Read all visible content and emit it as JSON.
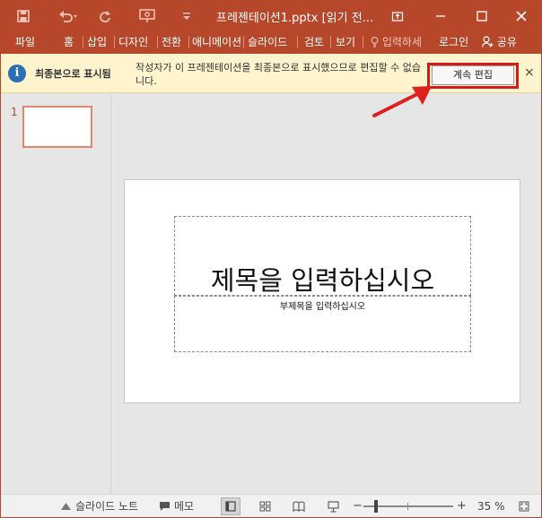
{
  "titlebar": {
    "title": "프레젠테이션1.pptx [읽기 전...",
    "qat_icons": [
      "save-icon",
      "undo-icon",
      "redo-icon",
      "presentation-icon",
      "customize-icon"
    ],
    "controls": [
      "restore-icon",
      "minimize-icon",
      "maximize-icon",
      "close-icon"
    ]
  },
  "ribbon": {
    "tabs": [
      "파일",
      "홈",
      "삽입",
      "디자인",
      "전환",
      "애니메이션",
      "슬라이드",
      "검토",
      "보기"
    ],
    "tell_me": "입력하세",
    "sign_in": "로그인",
    "share": "공유"
  },
  "message_bar": {
    "title": "최종본으로 표시됨",
    "text": "작성자가 이 프레젠테이션을 최종본으로 표시했으므로 편집할 수 없습니다.",
    "edit_button": "계속 편집",
    "close": "×"
  },
  "thumbnails": [
    {
      "number": "1"
    }
  ],
  "slide": {
    "title_placeholder": "제목을 입력하십시오",
    "subtitle_placeholder": "부제목을 입력하십시오"
  },
  "statusbar": {
    "notes": "슬라이드 노트",
    "comments": "메모",
    "zoom_minus": "−",
    "zoom_plus": "+",
    "zoom_percent": "35 %",
    "zoom_level": 0.35
  },
  "colors": {
    "accent": "#b7472a",
    "message_bar": "#fff4ce",
    "highlight": "#d41b1b"
  }
}
